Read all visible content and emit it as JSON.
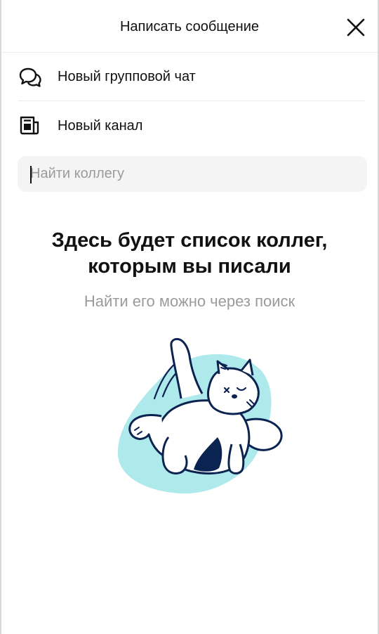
{
  "header": {
    "title": "Написать сообщение",
    "close_icon": "close-icon"
  },
  "menu": {
    "items": [
      {
        "label": "Новый групповой чат",
        "icon": "chat-bubbles-icon"
      },
      {
        "label": "Новый канал",
        "icon": "newspaper-icon"
      }
    ]
  },
  "search": {
    "placeholder": "Найти коллегу",
    "value": ""
  },
  "empty_state": {
    "title_line1": "Здесь будет список коллег,",
    "title_line2": "которым вы писали",
    "subtitle": "Найти его можно через поиск",
    "illustration": "sleeping-cat-illustration"
  },
  "colors": {
    "accent_blob": "#aee9ec",
    "ink": "#0b2350",
    "placeholder": "#9b9b9b",
    "search_bg": "#f4f4f4"
  }
}
